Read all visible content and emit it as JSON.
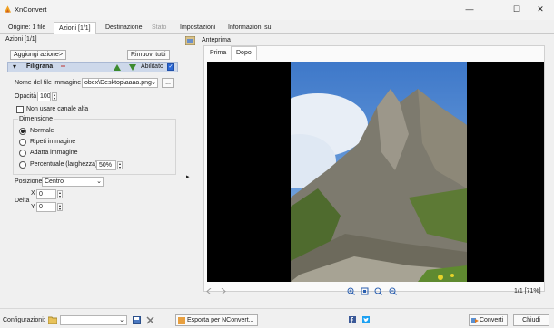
{
  "window": {
    "title": "XnConvert",
    "minimize_glyph": "—",
    "maximize_glyph": "☐",
    "close_glyph": "✕"
  },
  "tabs": [
    {
      "label": "Origine: 1 file"
    },
    {
      "label": "Azioni [1/1]"
    },
    {
      "label": "Destinazione"
    },
    {
      "label": "Stato"
    },
    {
      "label": "Impostazioni"
    },
    {
      "label": "Informazioni su"
    }
  ],
  "left": {
    "header": "Azioni [1/1]",
    "add_action": "Aggiungi azione>",
    "remove_all": "Rimuovi tutti",
    "action": {
      "name": "Filigrana",
      "enabled_label": "Abilitato",
      "expand_glyph": "▾",
      "remove_glyph": "═"
    },
    "filename_label": "Nome del file immagine",
    "filename_value": "obex\\Desktop\\aaaa.png",
    "browse_label": "...",
    "opacity_label": "Opacità",
    "opacity_value": "100",
    "no_alpha_label": "Non usare canale alfa",
    "dimension": {
      "title": "Dimensione",
      "options": [
        "Normale",
        "Ripeti immagine",
        "Adatta immagine",
        "Percentuale (larghezza)"
      ],
      "selected": "Normale",
      "percent_value": "50%"
    },
    "position_label": "Posizione",
    "position_value": "Centro",
    "delta_label": "Delta",
    "x_label": "X",
    "x_value": "0",
    "y_label": "Y",
    "y_value": "0"
  },
  "preview": {
    "header": "Anteprima",
    "tabs": [
      "Prima",
      "Dopo"
    ],
    "active_tab": "Dopo",
    "page_info": "1/1 [71%]"
  },
  "bottom": {
    "config_label": "Configurazioni:",
    "export_label": "Esporta per NConvert...",
    "convert_label": "Converti",
    "close_label": "Chiudi"
  },
  "colors": {
    "accent": "#2a67d6",
    "action_bar": "#cdd8ea"
  },
  "icons": [
    "app-logo-icon",
    "folder-icon",
    "save-icon",
    "delete-icon",
    "zoom-in-icon",
    "zoom-out-icon",
    "zoom-fit-icon",
    "facebook-icon",
    "twitter-icon",
    "convert-icon",
    "export-icon",
    "up-icon",
    "down-icon"
  ]
}
